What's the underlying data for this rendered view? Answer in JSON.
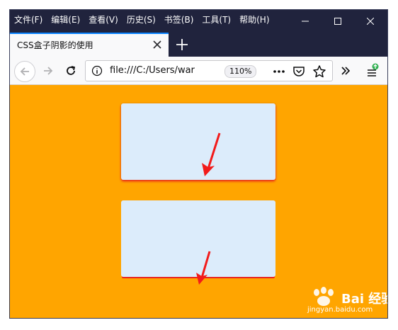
{
  "menubar": {
    "items": [
      "文件(F)",
      "编辑(E)",
      "查看(V)",
      "历史(S)",
      "书签(B)",
      "工具(T)",
      "帮助(H)"
    ]
  },
  "tab": {
    "title": "CSS盒子阴影的使用"
  },
  "urlbar": {
    "url": "file:///C:/Users/war",
    "zoom": "110%"
  },
  "content": {
    "background_color": "#ffa500",
    "box_color": "#dcecfb",
    "shadow_color": "#e8231d",
    "arrow_color": "#f21b1b"
  },
  "watermark": {
    "brand": "Bai 经验",
    "url": "jingyan.baidu.com"
  }
}
